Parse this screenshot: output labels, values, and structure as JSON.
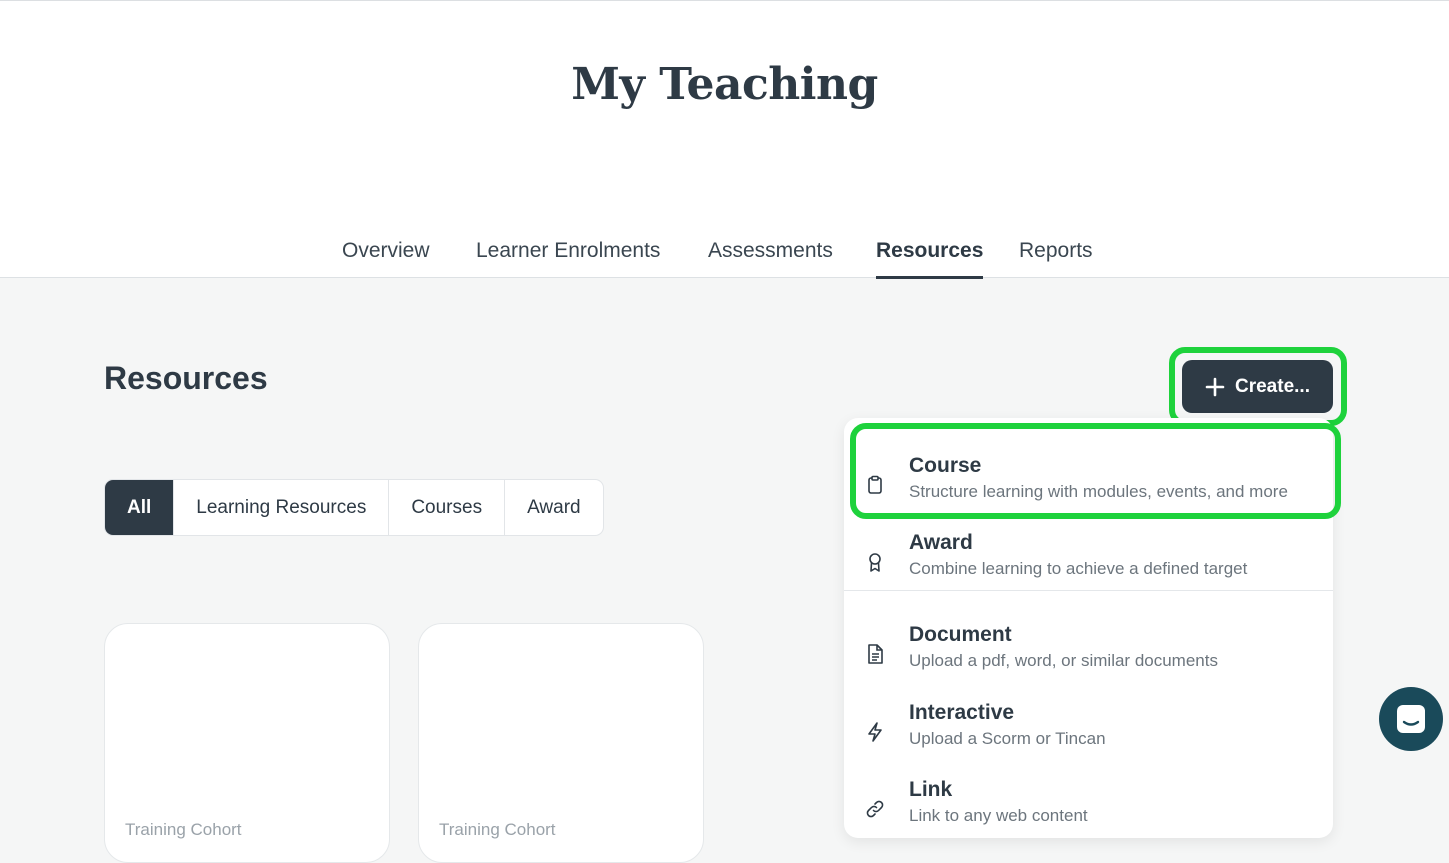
{
  "page": {
    "title": "My Teaching"
  },
  "tabs": [
    {
      "label": "Overview",
      "active": false
    },
    {
      "label": "Learner Enrolments",
      "active": false
    },
    {
      "label": "Assessments",
      "active": false
    },
    {
      "label": "Resources",
      "active": true
    },
    {
      "label": "Reports",
      "active": false
    }
  ],
  "section": {
    "title": "Resources"
  },
  "filters": [
    {
      "label": "All",
      "active": true
    },
    {
      "label": "Learning Resources",
      "active": false
    },
    {
      "label": "Courses",
      "active": false
    },
    {
      "label": "Award",
      "active": false
    }
  ],
  "create_button": {
    "label": "Create...",
    "icon": "plus-icon"
  },
  "create_menu": [
    {
      "title": "Course",
      "description": "Structure learning with modules, events, and more",
      "icon": "clipboard-icon"
    },
    {
      "title": "Award",
      "description": "Combine learning to achieve a defined target",
      "icon": "ribbon-icon"
    },
    {
      "title": "Document",
      "description": "Upload a pdf, word, or similar documents",
      "icon": "document-icon"
    },
    {
      "title": "Interactive",
      "description": "Upload a Scorm or Tincan",
      "icon": "lightning-icon"
    },
    {
      "title": "Link",
      "description": "Link to any web content",
      "icon": "link-icon"
    }
  ],
  "cards": [
    {
      "label": "Training Cohort"
    },
    {
      "label": "Training Cohort"
    }
  ],
  "colors": {
    "primary": "#2e3a45",
    "highlight": "#1ed23c",
    "chat": "#1a4a5a",
    "background": "#f5f6f6"
  }
}
